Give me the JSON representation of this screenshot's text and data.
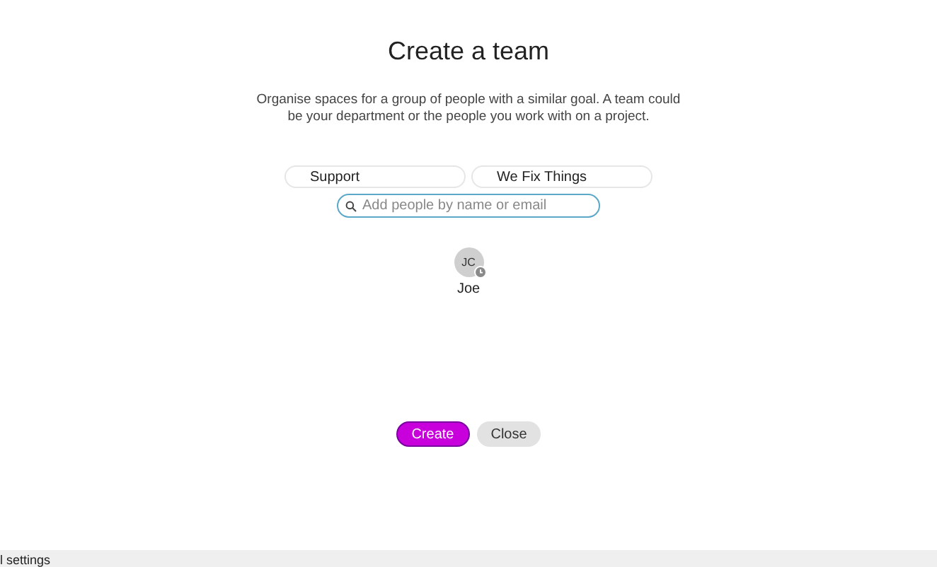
{
  "title": "Create a team",
  "description": "Organise spaces for a group of people with a similar goal. A team could be your department or the people you work with on a project.",
  "fields": [
    {
      "value": "Support"
    },
    {
      "value": "We Fix Things"
    }
  ],
  "search": {
    "placeholder": "Add people by name or email"
  },
  "members": [
    {
      "initials": "JC",
      "name": "Joe",
      "away": true
    }
  ],
  "buttons": [
    {
      "label": "Create",
      "kind": "primary"
    },
    {
      "label": "Close",
      "kind": "secondary"
    }
  ],
  "footer": {
    "text": "l settings"
  }
}
